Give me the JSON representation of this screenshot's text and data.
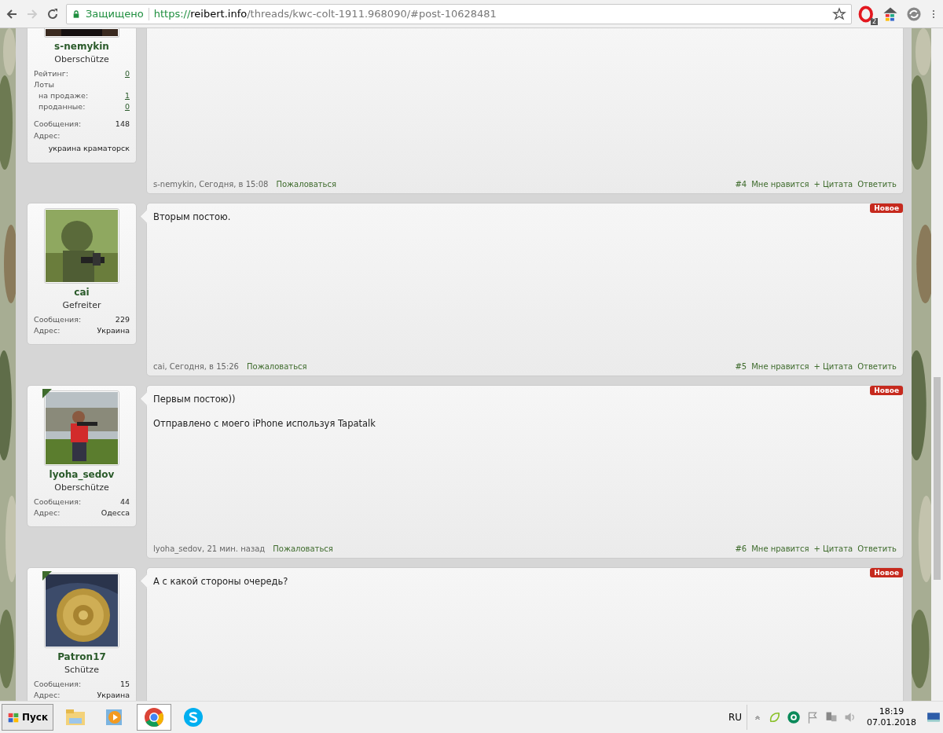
{
  "browser": {
    "security_label": "Защищено",
    "url": {
      "scheme": "https://",
      "host": "reibert.info",
      "path": "/threads/kwc-colt-1911.968090/#post-10628481"
    },
    "extension_badge": "2"
  },
  "posts": [
    {
      "user": {
        "name": "s-nemykin",
        "rank": "Oberschütze",
        "online": false,
        "stats": [
          {
            "label": "Рейтинг:",
            "value": "0",
            "kind": "link"
          },
          {
            "label": "Лоты",
            "kind": "heading",
            "children": [
              {
                "label": "на продаже:",
                "value": "1",
                "kind": "link"
              },
              {
                "label": "проданные:",
                "value": "0",
                "kind": "link"
              }
            ]
          },
          {
            "label": "Сообщения:",
            "value": "148",
            "kind": "count"
          },
          {
            "label": "Адрес:",
            "value": "украина краматорск",
            "kind": "stacked"
          }
        ]
      },
      "new": false,
      "footer": {
        "author": "s-nemykin",
        "time": ", Сегодня, в 15:08",
        "report": "Пожаловаться",
        "number": "#4",
        "like": "Мне нравится",
        "quote": "+ Цитата",
        "reply": "Ответить"
      }
    },
    {
      "user": {
        "name": "cai",
        "rank": "Gefreiter",
        "online": false,
        "stats": [
          {
            "label": "Сообщения:",
            "value": "229",
            "kind": "count"
          },
          {
            "label": "Адрес:",
            "value": "Украина",
            "kind": "count"
          }
        ]
      },
      "new": true,
      "badge": "Новое",
      "message": [
        "Вторым постою."
      ],
      "footer": {
        "author": "cai",
        "time": ", Сегодня, в 15:26",
        "report": "Пожаловаться",
        "number": "#5",
        "like": "Мне нравится",
        "quote": "+ Цитата",
        "reply": "Ответить"
      }
    },
    {
      "user": {
        "name": "lyoha_sedov",
        "rank": "Oberschütze",
        "online": true,
        "stats": [
          {
            "label": "Сообщения:",
            "value": "44",
            "kind": "count"
          },
          {
            "label": "Адрес:",
            "value": "Одесса",
            "kind": "count"
          }
        ]
      },
      "new": true,
      "badge": "Новое",
      "message": [
        "Первым постою))",
        "Отправлено с моего iPhone используя Tapatalk"
      ],
      "footer": {
        "author": "lyoha_sedov",
        "time": ", 21 мин. назад",
        "report": "Пожаловаться",
        "number": "#6",
        "like": "Мне нравится",
        "quote": "+ Цитата",
        "reply": "Ответить"
      }
    },
    {
      "user": {
        "name": "Patron17",
        "rank": "Schütze",
        "online": true,
        "stats": [
          {
            "label": "Сообщения:",
            "value": "15",
            "kind": "count"
          },
          {
            "label": "Адрес:",
            "value": "Украина",
            "kind": "count"
          }
        ]
      },
      "new": true,
      "badge": "Новое",
      "message": [
        "А с какой стороны очередь?"
      ]
    }
  ],
  "taskbar": {
    "start": "Пуск",
    "apps": [
      {
        "selected": false
      },
      {
        "selected": false
      },
      {
        "selected": true
      },
      {
        "selected": false
      }
    ],
    "language": "RU",
    "time": "18:19",
    "date": "07.01.2018"
  }
}
